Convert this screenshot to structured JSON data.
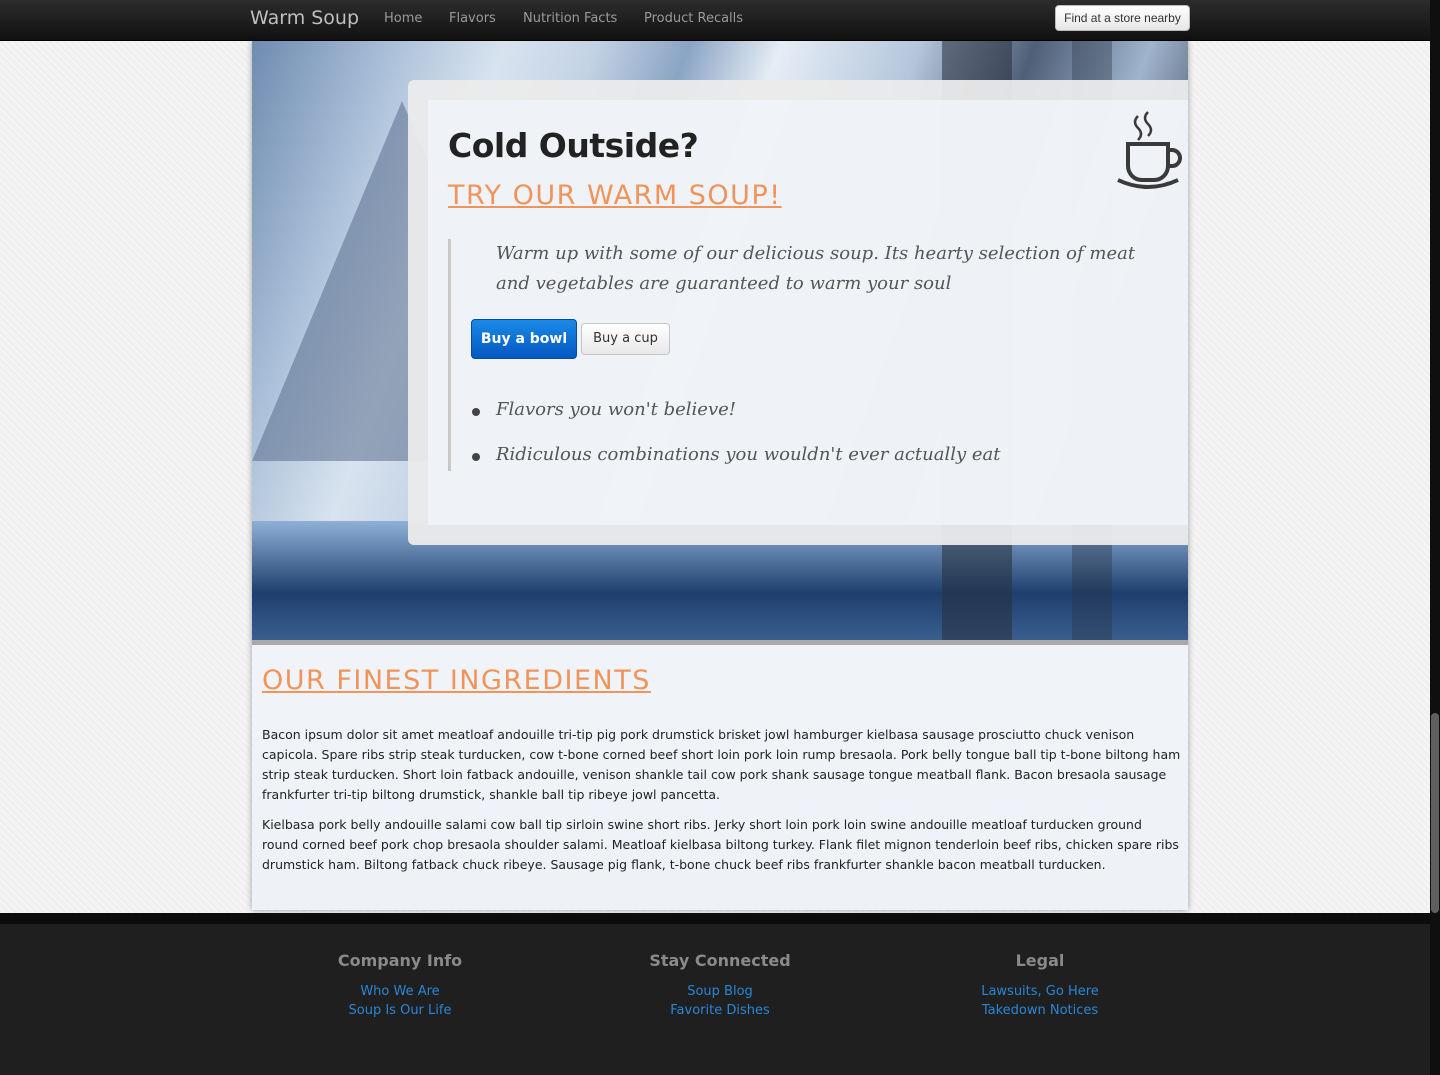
{
  "navbar": {
    "brand": "Warm Soup",
    "items": [
      {
        "label": "Home"
      },
      {
        "label": "Flavors"
      },
      {
        "label": "Nutrition Facts"
      },
      {
        "label": "Product Recalls"
      }
    ],
    "store_button": "Find at a store nearby"
  },
  "promo": {
    "title": "Cold Outside?",
    "subtitle": "TRY OUR WARM SOUP!",
    "quote": "Warm up with some of our delicious soup. Its hearty selection of meat and vegetables are guaranteed to warm your soul",
    "primary_button": "Buy a bowl",
    "secondary_button": "Buy a cup",
    "features": [
      "Flavors you won't believe!",
      "Ridiculous combinations you wouldn't ever actually eat"
    ],
    "icon": "coffee-cup-icon"
  },
  "ingredients": {
    "title": "OUR FINEST INGREDIENTS",
    "paragraphs": [
      "Bacon ipsum dolor sit amet meatloaf andouille tri-tip pig pork drumstick brisket jowl hamburger kielbasa sausage prosciutto chuck venison capicola. Spare ribs strip steak turducken, cow t-bone corned beef short loin pork loin rump bresaola. Pork belly tongue ball tip t-bone biltong ham strip steak turducken. Short loin fatback andouille, venison shankle tail cow pork shank sausage tongue meatball flank. Bacon bresaola sausage frankfurter tri-tip biltong drumstick, shankle ball tip ribeye jowl pancetta.",
      "Kielbasa pork belly andouille salami cow ball tip sirloin swine short ribs. Jerky short loin pork loin swine andouille meatloaf turducken ground round corned beef pork chop bresaola shoulder salami. Meatloaf kielbasa biltong turkey. Flank filet mignon tenderloin beef ribs, chicken spare ribs drumstick ham. Biltong fatback chuck ribeye. Sausage pig flank, t-bone chuck beef ribs frankfurter shankle bacon meatball turducken."
    ]
  },
  "footer": {
    "columns": [
      {
        "heading": "Company Info",
        "links": [
          "Who We Are",
          "Soup Is Our Life"
        ]
      },
      {
        "heading": "Stay Connected",
        "links": [
          "Soup Blog",
          "Favorite Dishes"
        ]
      },
      {
        "heading": "Legal",
        "links": [
          "Lawsuits, Go Here",
          "Takedown Notices"
        ]
      }
    ]
  },
  "colors": {
    "accent_orange": "#f0945a",
    "primary_blue": "#0457c2",
    "link_blue": "#2a86d6",
    "footer_bg": "#1f1f1f"
  }
}
